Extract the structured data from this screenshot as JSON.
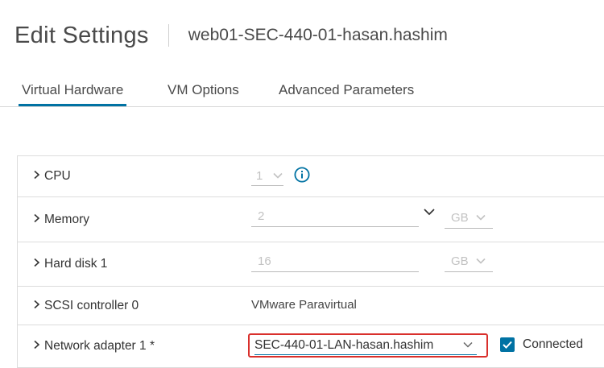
{
  "header": {
    "title": "Edit Settings",
    "vm_name": "web01-SEC-440-01-hasan.hashim"
  },
  "tabs": [
    {
      "label": "Virtual Hardware",
      "active": true
    },
    {
      "label": "VM Options",
      "active": false
    },
    {
      "label": "Advanced Parameters",
      "active": false
    }
  ],
  "hardware": {
    "cpu": {
      "label": "CPU",
      "value": "1"
    },
    "memory": {
      "label": "Memory",
      "value": "2",
      "unit": "GB"
    },
    "hard_disk": {
      "label": "Hard disk 1",
      "value": "16",
      "unit": "GB"
    },
    "scsi": {
      "label": "SCSI controller 0",
      "value": "VMware Paravirtual"
    },
    "network": {
      "label": "Network adapter 1 *",
      "value": "SEC-440-01-LAN-hasan.hashim",
      "connected_label": "Connected",
      "connected": true
    }
  },
  "colors": {
    "accent": "#0072a3",
    "highlight_border": "#d9302c",
    "disabled_text": "#c2c2c2"
  }
}
